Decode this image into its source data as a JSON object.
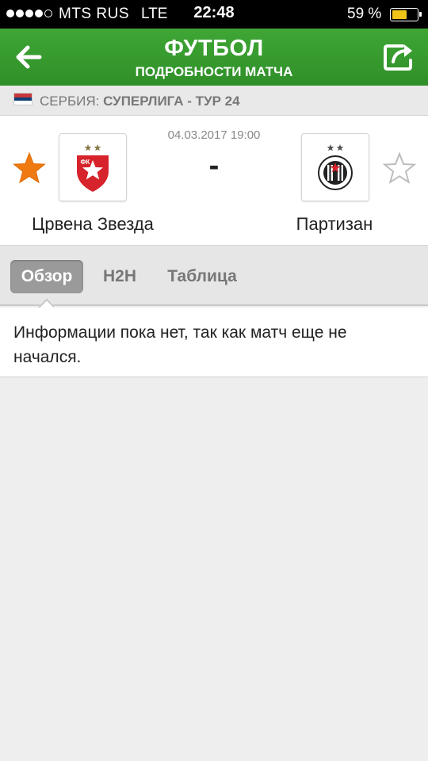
{
  "status_bar": {
    "carrier": "MTS RUS",
    "network": "LTE",
    "time": "22:48",
    "battery": "59 %",
    "battery_level": 0.59,
    "signal_bars_filled": 4,
    "signal_bars_total": 5
  },
  "header": {
    "title": "ФУТБОЛ",
    "subtitle": "ПОДРОБНОСТИ МАТЧА",
    "back_icon": "arrow-left-icon",
    "share_icon": "share-icon",
    "color": "#3a9e30"
  },
  "league": {
    "country": "СЕРБИЯ:",
    "competition": "СУПЕРЛИГА - ТУР 24",
    "flag_icon": "serbia-flag-icon"
  },
  "match": {
    "date": "04.03.2017 19:00",
    "score": "-",
    "home": {
      "name": "Црвена Звезда",
      "favorite": true,
      "logo_icon": "crvena-zvezda-crest-icon",
      "logo_text": "ФК"
    },
    "away": {
      "name": "Партизан",
      "favorite": false,
      "logo_icon": "partizan-crest-icon"
    },
    "favorite_color": "#f07a12"
  },
  "tabs": [
    {
      "label": "Обзор",
      "active": true
    },
    {
      "label": "H2H",
      "active": false
    },
    {
      "label": "Таблица",
      "active": false
    }
  ],
  "content": {
    "message": "Информации пока нет, так как матч еще не начался."
  }
}
